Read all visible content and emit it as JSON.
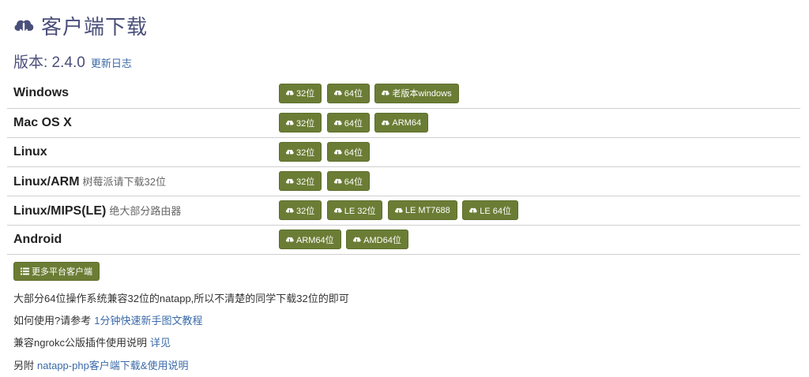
{
  "header": {
    "title": "客户端下载",
    "version": "版本: 2.4.0",
    "changelog_link": "更新日志"
  },
  "colors": {
    "button_bg": "#6b7d35",
    "title": "#4a4f7a",
    "link": "#3a6aa8"
  },
  "icons": {
    "title": "cloud-download-icon",
    "button": "cloud-download-icon",
    "more": "list-icon"
  },
  "platforms": [
    {
      "name": "Windows",
      "note": "",
      "buttons": [
        "32位",
        "64位",
        "老版本windows"
      ]
    },
    {
      "name": "Mac OS X",
      "note": "",
      "buttons": [
        "32位",
        "64位",
        "ARM64"
      ]
    },
    {
      "name": "Linux",
      "note": "",
      "buttons": [
        "32位",
        "64位"
      ]
    },
    {
      "name": "Linux/ARM",
      "note": "树莓派请下载32位",
      "buttons": [
        "32位",
        "64位"
      ]
    },
    {
      "name": "Linux/MIPS(LE)",
      "note": "绝大部分路由器",
      "buttons": [
        "32位",
        "LE 32位",
        "LE MT7688",
        "LE 64位"
      ]
    },
    {
      "name": "Android",
      "note": "",
      "buttons": [
        "ARM64位",
        "AMD64位"
      ]
    }
  ],
  "more_button": "更多平台客户端",
  "info": {
    "line1": "大部分64位操作系统兼容32位的natapp,所以不清楚的同学下载32位的即可",
    "line2_text": "如何使用?请参考",
    "line2_link": "1分钟快速新手图文教程",
    "line3_text": "兼容ngrokc公版插件使用说明",
    "line3_link": "详见",
    "line4_text": "另附",
    "line4_link": "natapp-php客户端下载&使用说明"
  }
}
